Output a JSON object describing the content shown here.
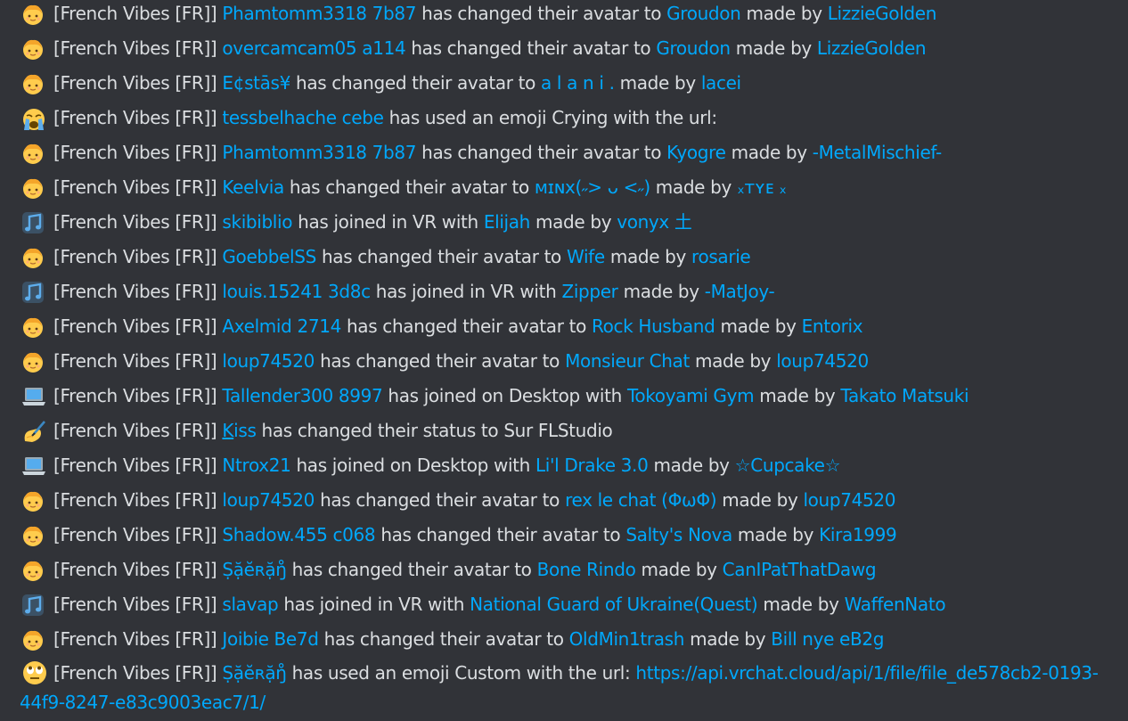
{
  "server_tag": "[French Vibes [FR]]",
  "colors": {
    "background": "#313338",
    "text": "#dbdee1",
    "link": "#00a8fc"
  },
  "lines": [
    {
      "icon": "avatar-face-icon",
      "user": "Phamtomm3318 7b87",
      "action": "has changed their avatar to",
      "target": "Groudon",
      "by_label": "made by",
      "author": "LizzieGolden"
    },
    {
      "icon": "avatar-face-icon",
      "user": "overcamcam05 a114",
      "action": "has changed their avatar to",
      "target": "Groudon",
      "by_label": "made by",
      "author": "LizzieGolden"
    },
    {
      "icon": "avatar-face-icon",
      "user": "E¢stās¥",
      "action": "has changed their avatar to",
      "target": "a l a n i .",
      "by_label": "made by",
      "author": "lacei"
    },
    {
      "icon": "crying-face-icon",
      "user": "tessbelhache cebe",
      "action": "has used an emoji Crying with the url:",
      "target": "",
      "by_label": "",
      "author": ""
    },
    {
      "icon": "avatar-face-icon",
      "user": "Phamtomm3318 7b87",
      "action": "has changed their avatar to",
      "target": "Kyogre",
      "by_label": "made by",
      "author": "-MetalMischief-"
    },
    {
      "icon": "avatar-face-icon",
      "user": "Keelvia",
      "action": "has changed their avatar to",
      "target": "ᴍɪɴx(˶> ᴗ <˶)",
      "by_label": "made by",
      "author": "ₓᴛʏᴇ ₓ"
    },
    {
      "icon": "vr-music-icon",
      "user": "skibiblio",
      "action": "has joined in VR with",
      "target": "Elijah",
      "by_label": "made by",
      "author": "vonyx 土"
    },
    {
      "icon": "avatar-face-icon",
      "user": "GoebbelSS",
      "action": "has changed their avatar to",
      "target": "Wife",
      "by_label": "made by",
      "author": "rosarie"
    },
    {
      "icon": "vr-music-icon",
      "user": "louis.15241 3d8c",
      "action": "has joined in VR with",
      "target": "Zipper",
      "by_label": "made by",
      "author": "-MatJoy-"
    },
    {
      "icon": "avatar-face-icon",
      "user": "Axelmid 2714",
      "action": "has changed their avatar to",
      "target": "Rock Husband",
      "by_label": "made by",
      "author": "Entorix"
    },
    {
      "icon": "avatar-face-icon",
      "user": "loup74520",
      "action": "has changed their avatar to",
      "target": "Monsieur Chat",
      "by_label": "made by",
      "author": "loup74520"
    },
    {
      "icon": "laptop-icon",
      "user": "Tallender300 8997",
      "action": "has joined on Desktop with",
      "target": "Tokoyami Gym",
      "by_label": "made by",
      "author": "Takato Matsuki"
    },
    {
      "icon": "writing-hand-icon",
      "user": "Kiss",
      "action": "has changed their status to  Sur FLStudio",
      "target": "",
      "by_label": "",
      "author": ""
    },
    {
      "icon": "laptop-icon",
      "user": "Ntrox21",
      "action": "has joined on Desktop with",
      "target": "Li'l Drake 3.0",
      "by_label": "made by",
      "author": "☆Cupcake☆"
    },
    {
      "icon": "avatar-face-icon",
      "user": "loup74520",
      "action": "has changed their avatar to",
      "target": "rex le chat (ΦωΦ)",
      "by_label": "made by",
      "author": "loup74520"
    },
    {
      "icon": "avatar-face-icon",
      "user": "Shadow.455 c068",
      "action": "has changed their avatar to",
      "target": "Salty's Nova",
      "by_label": "made by",
      "author": "Kira1999"
    },
    {
      "icon": "avatar-face-icon",
      "user": "Ṣặĕʀặŋ̊",
      "action": "has changed their avatar to",
      "target": "Bone Rindo",
      "by_label": "made by",
      "author": "CanIPatThatDawg"
    },
    {
      "icon": "vr-music-icon",
      "user": "slavap",
      "action": "has joined in VR with",
      "target": "National Guard of Ukraine(Quest)",
      "by_label": "made by",
      "author": "WaffenNato"
    },
    {
      "icon": "avatar-face-icon",
      "user": "Joibie Be7d",
      "action": "has changed their avatar to",
      "target": "OldMin1trash",
      "by_label": "made by",
      "author": "Bill nye eB2g"
    },
    {
      "icon": "rolling-eyes-icon",
      "user": "Ṣặĕʀặŋ̊",
      "action": "has used an emoji Custom with the url:",
      "target": "https://api.vrchat.cloud/api/1/file/file_de578cb2-0193-44f9-8247-e83c9003eac7/1/",
      "by_label": "",
      "author": ""
    }
  ]
}
